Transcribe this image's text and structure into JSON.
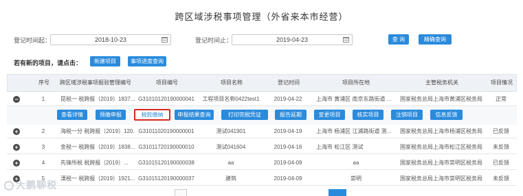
{
  "title": "跨区域涉税事项管理（外省来本市经营）",
  "filter": {
    "start_label": "登记时间起：",
    "start_value": "2018-10-23",
    "end_label": "登记时间止：",
    "end_value": "2019-04-23",
    "query_btn": "查 询",
    "precise_btn": "精确查询"
  },
  "prompt": "若有新的项目，请点击：",
  "new_project_btn": "新建项目",
  "progress_btn": "事项进度查询",
  "table": {
    "headers": [
      "序号",
      "跨区域涉税事项报验管理编号",
      "项目编号",
      "项目名称",
      "登记时间",
      "项目所在地",
      "主管税务机关",
      "项目情况"
    ],
    "rows": [
      {
        "no": "1",
        "code": "昆税一 税跨报〔2019〕1837...",
        "pid": "G31010120190000041",
        "name": "工程项目名称0422test1",
        "date": "2019-04-22",
        "loc": "上海市 黄浦区 南京东路街道 ...",
        "org": "国家税务总局上海市黄浦区税务局",
        "status": "正常"
      },
      {
        "no": "2",
        "code": "海税一分 税跨报〔2019〕120...",
        "pid": "G31011020190000001",
        "name": "测试041901",
        "date": "2019-04-19",
        "loc": "上海市 杨浦区 江浦路街道 测...",
        "org": "国家税务总局上海市杨浦区税务局",
        "status": "已反馈"
      },
      {
        "no": "3",
        "code": "金税一 税跨报〔2019〕1838...",
        "pid": "G31011720190000010",
        "name": "测试041604",
        "date": "2019-04-16",
        "loc": "上海市 松江区 测试",
        "org": "国家税务总局上海市松江区税务局",
        "status": "未反馈"
      },
      {
        "no": "4",
        "code": "先锋所税 税跨报〔2019〕...",
        "pid": "G31015120190000038",
        "name": "aa",
        "date": "2019-04-09",
        "loc": "aa",
        "org": "国家税务总局上海市崇明区税务局",
        "status": "已反馈"
      },
      {
        "no": "5",
        "code": "溧税一 税跨报〔2019〕1921...",
        "pid": "G31015120190000037",
        "name": "建筑",
        "date": "2019-04-09",
        "loc": "崇明",
        "org": "国家税务总局上海市崇明区税务局",
        "status": "未反馈"
      }
    ]
  },
  "actions": [
    "查看详情",
    "预缴申报",
    "税款缴纳",
    "申报结果查询",
    "打印完税凭证",
    "报告延期",
    "变更项目",
    "核实项目",
    "注销项目",
    "信息反馈"
  ],
  "icons": {
    "calendar": "calendar-icon",
    "collapse": "minus-circle-icon",
    "expand": "plus-circle-icon"
  },
  "colors": {
    "primary": "#2a8bdc",
    "highlight_border": "#d9261c"
  },
  "watermark": "大鹏聊税"
}
